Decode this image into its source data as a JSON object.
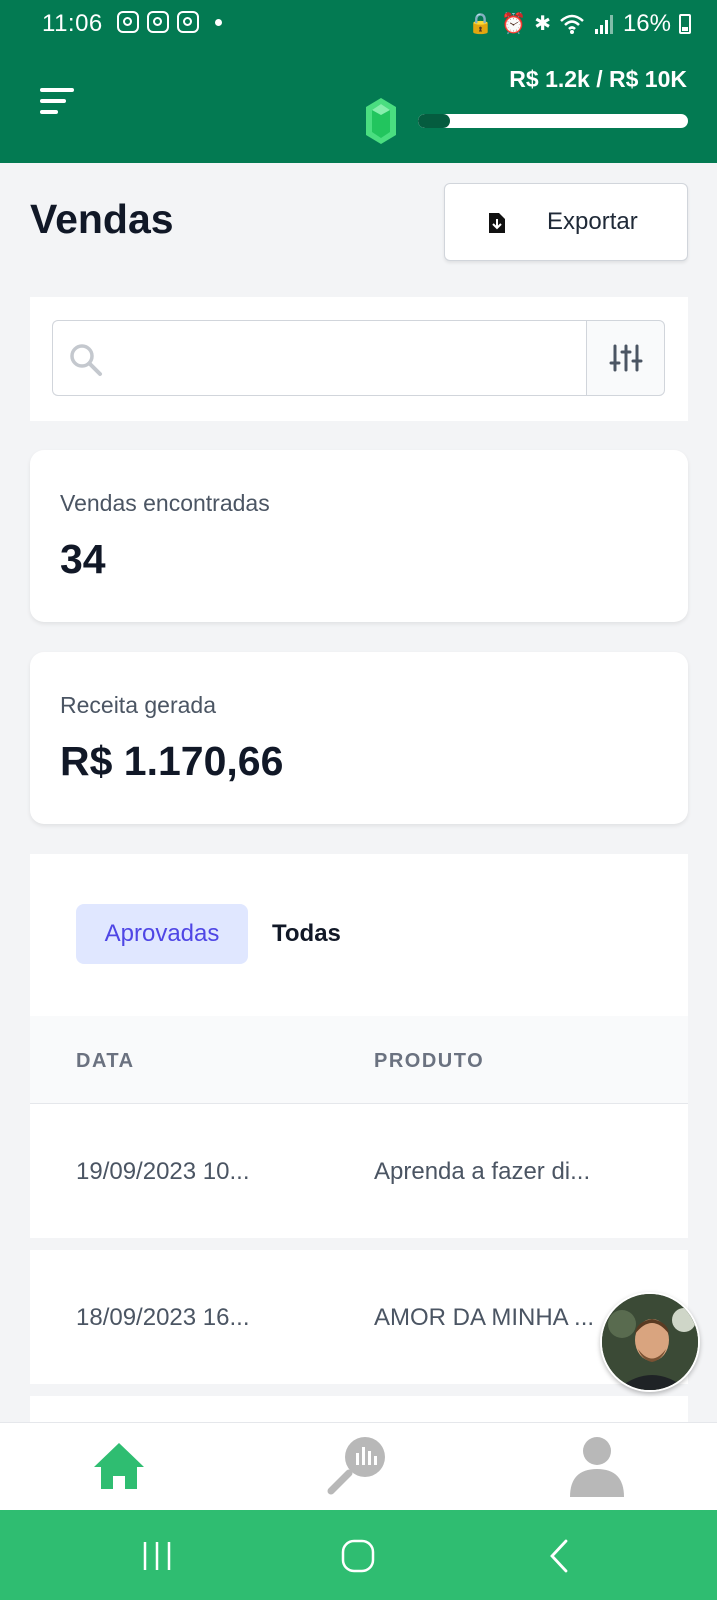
{
  "status_bar": {
    "time": "11:06",
    "battery": "16%"
  },
  "header": {
    "goal_text": "R$ 1.2k / R$ 10K",
    "progress_fraction": 0.12
  },
  "page": {
    "title": "Vendas",
    "export_label": "Exportar"
  },
  "search": {
    "value": "",
    "placeholder": ""
  },
  "stats": [
    {
      "label": "Vendas encontradas",
      "value": "34"
    },
    {
      "label": "Receita gerada",
      "value": "R$ 1.170,66"
    }
  ],
  "tabs": [
    {
      "label": "Aprovadas",
      "active": true
    },
    {
      "label": "Todas",
      "active": false
    }
  ],
  "table": {
    "columns": [
      "DATA",
      "PRODUTO"
    ],
    "rows": [
      {
        "data": "19/09/2023 10...",
        "produto": "Aprenda a fazer di..."
      },
      {
        "data": "18/09/2023 16...",
        "produto": "AMOR DA MINHA ..."
      }
    ]
  },
  "colors": {
    "header_green": "#037a52",
    "active_tab_bg": "#e0e7ff",
    "active_tab_text": "#4f46e5",
    "nav_active": "#2fbd71",
    "system_nav": "#2fbd71"
  },
  "icons": {
    "menu": "menu-icon",
    "gem": "gem-icon",
    "export": "file-download-icon",
    "search": "search-icon",
    "filter": "sliders-icon",
    "nav_home": "home-icon",
    "nav_reports": "analytics-search-icon",
    "nav_profile": "user-icon"
  }
}
